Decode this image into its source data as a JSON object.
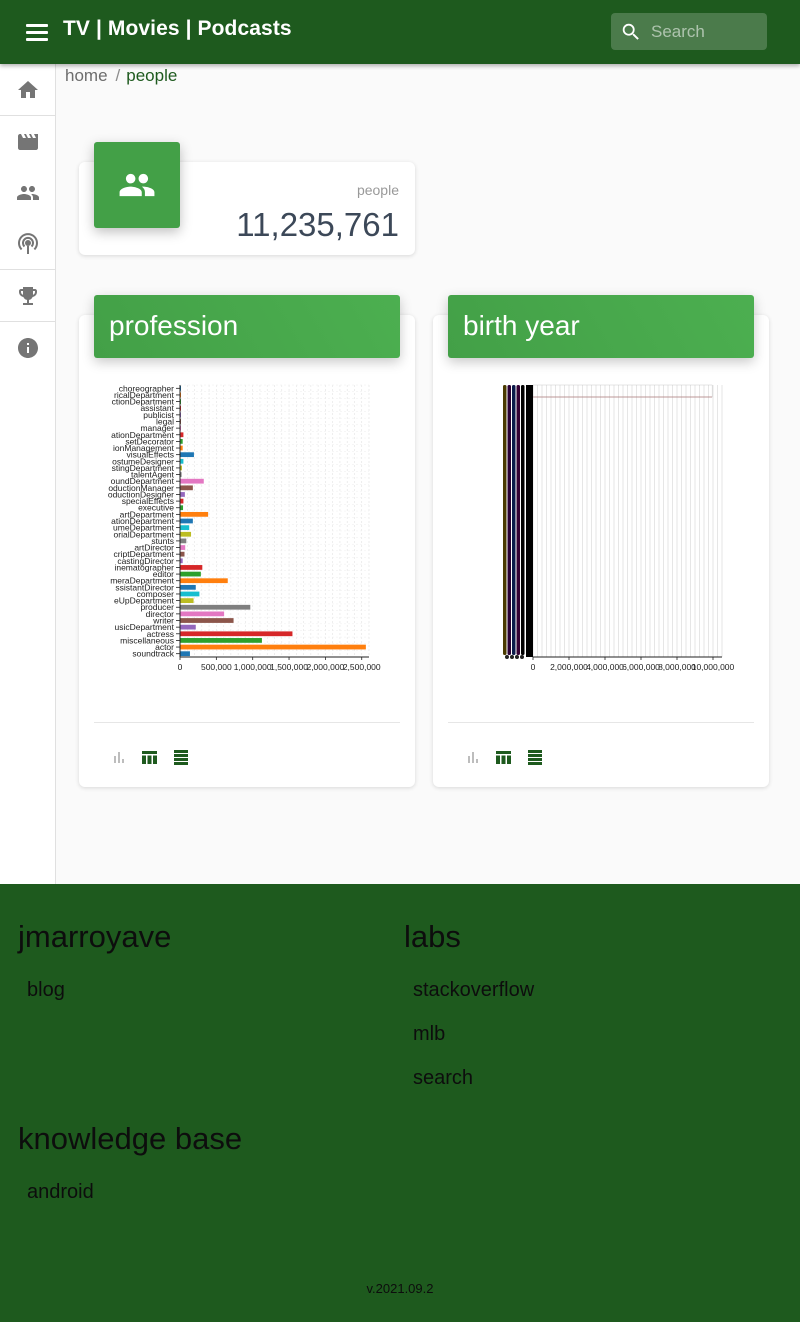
{
  "header": {
    "title": "TV | Movies | Podcasts",
    "search_placeholder": "Search"
  },
  "sidenav": {
    "items": [
      {
        "name": "home",
        "icon": "home-icon"
      },
      {
        "name": "movies",
        "icon": "movie-icon"
      },
      {
        "name": "people",
        "icon": "people-icon"
      },
      {
        "name": "podcasts",
        "icon": "podcast-icon"
      },
      {
        "name": "awards",
        "icon": "trophy-icon"
      },
      {
        "name": "info",
        "icon": "info-icon"
      }
    ]
  },
  "breadcrumb": {
    "home": "home",
    "separator": "/",
    "current": "people"
  },
  "stat": {
    "label": "people",
    "value": "11,235,761"
  },
  "cards": {
    "profession_title": "profession",
    "birth_year_title": "birth year"
  },
  "chart_data": [
    {
      "type": "bar",
      "orientation": "horizontal",
      "title": "profession",
      "categories": [
        "choreographer",
        "electricalDepartment",
        "productionDepartment",
        "assistant",
        "publicist",
        "legal",
        "manager",
        "locationManagement",
        "setDecorator",
        "transportationDepartment",
        "visualEffects",
        "costumeDesigner",
        "castingDepartment",
        "talentAgent",
        "soundDepartment",
        "productionManager",
        "productionDesigner",
        "specialEffects",
        "executive",
        "artDepartment",
        "animationDepartment",
        "costumeDepartment",
        "editorialDepartment",
        "stunts",
        "artDirector",
        "scriptDepartment",
        "castingDirector",
        "cinematographer",
        "editor",
        "cameraDepartment",
        "assistantDirector",
        "composer",
        "makeUpDepartment",
        "producer",
        "director",
        "writer",
        "musicDepartment",
        "actress",
        "miscellaneous",
        "actor",
        "soundtrack"
      ],
      "tick_labels_as_printed": [
        "choreographer",
        "ricalDepartment",
        "ctionDepartment",
        "assistant",
        "publicist",
        "legal",
        "manager",
        "ationDepartment",
        "setDecorator",
        "ionManagement",
        "visualEffects",
        "ostumeDesigner",
        "stingDepartment",
        "talentAgent",
        "oundDepartment",
        "oductionManager",
        "oductionDesigner",
        "specialEffects",
        "executive",
        "artDepartment",
        "ationDepartment",
        "umeDepartment",
        "orialDepartment",
        "stunts",
        "artDirector",
        "criptDepartment",
        "castingDirector",
        "inematographer",
        "editor",
        "meraDepartment",
        "ssistantDirector",
        "composer",
        "eUpDepartment",
        "producer",
        "director",
        "writer",
        "usicDepartment",
        "actress",
        "miscellaneous",
        "actor",
        "soundtrack"
      ],
      "values": [
        3000,
        3000,
        3000,
        3000,
        4000,
        5000,
        6000,
        40000,
        30000,
        30000,
        185000,
        40000,
        20000,
        15000,
        320000,
        170000,
        60000,
        40000,
        35000,
        380000,
        170000,
        120000,
        145000,
        80000,
        65000,
        55000,
        30000,
        300000,
        280000,
        650000,
        210000,
        260000,
        180000,
        960000,
        600000,
        730000,
        210000,
        1540000,
        1120000,
        2550000,
        130000
      ],
      "bar_colors": [
        "#1f77b4",
        "#ff7f0e",
        "#2ca02c",
        "#d62728",
        "#9467bd",
        "#8c564b",
        "#e377c2",
        "#d62728",
        "#2ca02c",
        "#ff7f0e",
        "#1f77b4",
        "#17becf",
        "#bcbd22",
        "#7f7f7f",
        "#e377c2",
        "#8c564b",
        "#9467bd",
        "#d62728",
        "#2ca02c",
        "#ff7f0e",
        "#1f77b4",
        "#17becf",
        "#bcbd22",
        "#7f7f7f",
        "#e377c2",
        "#8c564b",
        "#9467bd",
        "#d62728",
        "#2ca02c",
        "#ff7f0e",
        "#1f77b4",
        "#17becf",
        "#bcbd22",
        "#7f7f7f",
        "#e377c2",
        "#8c564b",
        "#9467bd",
        "#d62728",
        "#2ca02c",
        "#ff7f0e",
        "#1f77b4"
      ],
      "x_ticks": [
        "0",
        "500,000",
        "1,000,000",
        "1,500,000",
        "2,000,000",
        "2,500,000"
      ],
      "xlim": [
        0,
        2600000
      ],
      "grid": true
    },
    {
      "type": "bar",
      "orientation": "horizontal",
      "title": "birth year",
      "x_ticks": [
        "0",
        "2,000,000",
        "4,000,000",
        "6,000,000",
        "8,000,000",
        "10,000,000"
      ],
      "xlim": [
        0,
        10500000
      ],
      "note_values": [
        9950000
      ],
      "grid": true
    }
  ],
  "footer": {
    "col1_title": "jmarroyave",
    "col1_links": [
      "blog"
    ],
    "col2_title": "labs",
    "col2_links": [
      "stackoverflow",
      "mlb",
      "search"
    ],
    "col3_title": "knowledge base",
    "col3_links": [
      "android"
    ],
    "version": "v.2021.09.2"
  },
  "colors": {
    "primary": "#1e5a1e",
    "card_header": "#43a047"
  }
}
